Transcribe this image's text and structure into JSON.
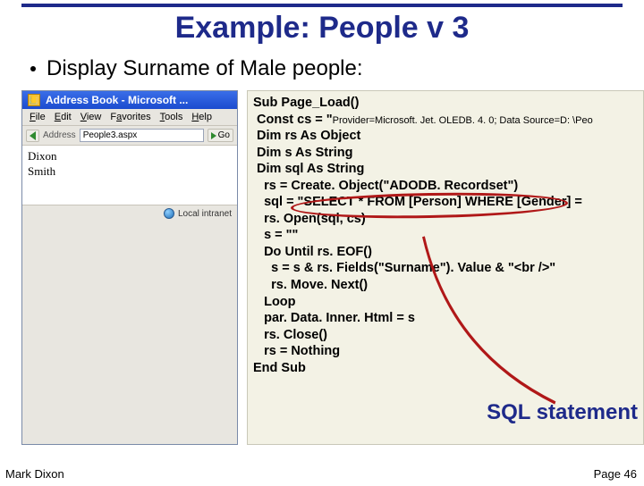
{
  "slide": {
    "title": "Example: People v 3",
    "bullet": "Display Surname of Male people:"
  },
  "browser": {
    "title": "Address Book - Microsoft ...",
    "menu": {
      "file": "File",
      "edit": "Edit",
      "view": "View",
      "favorites": "Favorites",
      "tools": "Tools",
      "help": "Help"
    },
    "address_label": "Address",
    "address_value": "People3.aspx",
    "go_label": "Go",
    "body_line1": "Dixon",
    "body_line2": "Smith",
    "status": "Local intranet"
  },
  "code": {
    "l01": "Sub Page_Load()",
    "l02a": " Const cs = \"",
    "l02b": "Provider=Microsoft. Jet. OLEDB. 4. 0; Data Source=D: \\Peo",
    "l03": " Dim rs As Object",
    "l04": " Dim s As String",
    "l05": " Dim sql As String",
    "l06": "   rs = Create. Object(\"ADODB. Recordset\")",
    "l07": "   sql = \"SELECT * FROM [Person] WHERE [Gender] =",
    "l08": "   rs. Open(sql, cs)",
    "l09": "   s = \"\"",
    "l10": "   Do Until rs. EOF()",
    "l11": "     s = s & rs. Fields(\"Surname\"). Value & \"<br />\"",
    "l12": "     rs. Move. Next()",
    "l13": "   Loop",
    "l14": "   par. Data. Inner. Html = s",
    "l15": "   rs. Close()",
    "l16": "   rs = Nothing",
    "l17": "End Sub"
  },
  "callout": "SQL statement",
  "footer": {
    "author": "Mark Dixon",
    "page": "Page 46"
  }
}
